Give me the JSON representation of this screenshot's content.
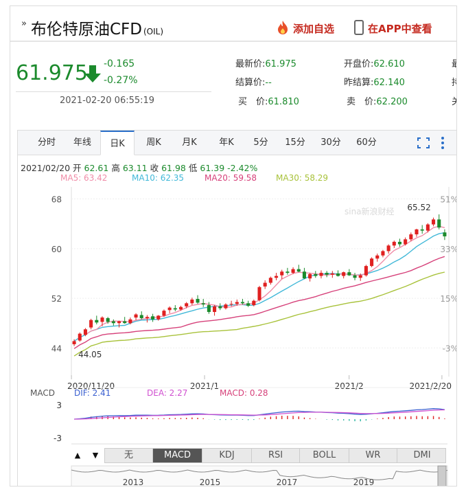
{
  "header": {
    "mark": "»",
    "title": "布伦特原油CFD",
    "title_sub": "(OIL)",
    "favorite_label": "添加自选",
    "app_label": "在APP中查看"
  },
  "price": {
    "last": "61.975",
    "change": "-0.165",
    "change_pct": "-0.27%",
    "time": "2021-02-20 06:55:19"
  },
  "quotes": [
    {
      "label": "最新价:",
      "value": "61.975"
    },
    {
      "label": "结算价:",
      "value": "--"
    },
    {
      "label": "买　价:",
      "value": "61.810"
    },
    {
      "label": "开盘价:",
      "value": "62.610"
    },
    {
      "label": "昨结算:",
      "value": "62.140"
    },
    {
      "label": "卖　价:",
      "value": "62.200"
    }
  ],
  "edge_partial": [
    "最",
    "持",
    "关"
  ],
  "tabs": [
    "分时",
    "年线",
    "日K",
    "周K",
    "月K",
    "年K",
    "5分",
    "15分",
    "30分",
    "60分"
  ],
  "active_tab": "日K",
  "info": {
    "date": "2021/02/20",
    "open_label": "开",
    "open": "62.61",
    "high_label": "高",
    "high": "63.11",
    "close_label": "收",
    "close": "61.98",
    "low_label": "低",
    "low": "61.39",
    "pct": "-2.42%",
    "ma5": "MA5: 63.42",
    "ma10": "MA10: 62.35",
    "ma20": "MA20: 59.58",
    "ma30": "MA30: 58.29"
  },
  "watermark": "sina新浪财经",
  "macd": {
    "label": "MACD",
    "dif": "DIF: 2.41",
    "dea": "DEA: 2.27",
    "macd": "MACD: 0.28"
  },
  "bottom_tabs": [
    "无",
    "MACD",
    "KDJ",
    "RSI",
    "BOLL",
    "WR",
    "DMI"
  ],
  "bottom_active": "MACD",
  "nav": [
    "▲",
    "▼"
  ],
  "colors": {
    "up": "#e02020",
    "down": "#1b8a2c",
    "ma5": "#f08ca8",
    "ma10": "#41b8d8",
    "ma20": "#d6417a",
    "ma30": "#a8c23a",
    "dif": "#3a5fd0",
    "dea": "#d050d0"
  },
  "chart_data": {
    "type": "candlestick",
    "y_ticks_left": [
      "68",
      "60",
      "52",
      "44"
    ],
    "y_ticks_right": [
      "51%",
      "33%",
      "15%",
      "-3%"
    ],
    "x_ticks": [
      "2020/11/20",
      "2021/1",
      "2021/2",
      "2021/2/20"
    ],
    "annotations": {
      "high": "65.52",
      "low": "44.05"
    },
    "ylim": [
      40.5,
      69.5
    ],
    "candles": [
      [
        44.6,
        45.4,
        44.3,
        45.1
      ],
      [
        45.2,
        46.5,
        45.0,
        46.3
      ],
      [
        46.1,
        47.2,
        45.9,
        47.0
      ],
      [
        47.3,
        48.7,
        47.0,
        48.5
      ],
      [
        48.5,
        49.2,
        47.8,
        48.1
      ],
      [
        48.2,
        49.1,
        47.5,
        48.9
      ],
      [
        48.8,
        49.0,
        47.9,
        48.2
      ],
      [
        48.3,
        48.6,
        47.6,
        48.0
      ],
      [
        48.0,
        48.4,
        47.3,
        48.3
      ],
      [
        48.3,
        49.0,
        47.9,
        48.0
      ],
      [
        48.0,
        48.9,
        47.8,
        48.6
      ],
      [
        48.9,
        49.6,
        48.5,
        49.4
      ],
      [
        49.3,
        49.9,
        48.6,
        48.8
      ],
      [
        48.8,
        49.3,
        48.1,
        49.0
      ],
      [
        49.1,
        49.5,
        48.2,
        48.6
      ],
      [
        48.6,
        49.3,
        48.4,
        49.2
      ],
      [
        49.2,
        50.2,
        49.0,
        50.0
      ],
      [
        50.1,
        50.7,
        49.6,
        50.5
      ],
      [
        50.4,
        50.9,
        49.9,
        50.2
      ],
      [
        50.2,
        50.8,
        50.0,
        50.6
      ],
      [
        50.7,
        51.4,
        50.4,
        51.2
      ],
      [
        51.2,
        52.1,
        50.9,
        51.8
      ],
      [
        51.9,
        52.5,
        51.1,
        51.3
      ],
      [
        51.2,
        51.9,
        50.6,
        51.0
      ],
      [
        50.9,
        51.4,
        49.5,
        49.8
      ],
      [
        49.8,
        50.9,
        49.2,
        50.7
      ],
      [
        50.7,
        51.2,
        50.1,
        50.4
      ],
      [
        50.4,
        51.2,
        50.2,
        51.0
      ],
      [
        51.0,
        51.6,
        50.7,
        51.1
      ],
      [
        51.1,
        51.8,
        50.8,
        51.4
      ],
      [
        51.4,
        51.9,
        51.0,
        51.2
      ],
      [
        51.2,
        51.6,
        50.6,
        50.8
      ],
      [
        50.9,
        51.8,
        50.7,
        51.6
      ],
      [
        51.7,
        54.0,
        51.5,
        53.8
      ],
      [
        53.9,
        54.9,
        53.5,
        54.5
      ],
      [
        54.5,
        55.5,
        54.2,
        55.3
      ],
      [
        55.3,
        56.1,
        54.9,
        55.6
      ],
      [
        55.7,
        56.6,
        55.1,
        56.3
      ],
      [
        56.3,
        56.9,
        55.8,
        56.1
      ],
      [
        56.1,
        57.0,
        55.9,
        56.7
      ],
      [
        56.7,
        57.4,
        56.2,
        56.3
      ],
      [
        56.3,
        56.9,
        55.1,
        55.2
      ],
      [
        55.2,
        56.1,
        54.7,
        55.9
      ],
      [
        55.9,
        56.4,
        55.3,
        55.6
      ],
      [
        55.6,
        56.5,
        55.2,
        56.1
      ],
      [
        56.1,
        56.4,
        55.4,
        55.8
      ],
      [
        55.8,
        56.4,
        55.3,
        56.0
      ],
      [
        56.0,
        56.5,
        55.5,
        55.6
      ],
      [
        55.6,
        56.3,
        55.2,
        56.2
      ],
      [
        56.2,
        56.7,
        55.6,
        55.7
      ],
      [
        55.7,
        56.1,
        54.9,
        55.3
      ],
      [
        55.3,
        56.0,
        54.8,
        55.7
      ],
      [
        55.7,
        57.4,
        55.5,
        57.2
      ],
      [
        57.2,
        58.6,
        57.0,
        58.4
      ],
      [
        58.4,
        59.2,
        57.9,
        58.9
      ],
      [
        58.9,
        59.8,
        58.6,
        59.6
      ],
      [
        59.6,
        60.7,
        59.2,
        60.5
      ],
      [
        60.5,
        61.3,
        60.1,
        61.1
      ],
      [
        61.1,
        61.6,
        60.3,
        60.7
      ],
      [
        60.7,
        61.8,
        60.5,
        61.5
      ],
      [
        61.5,
        62.6,
        61.2,
        62.3
      ],
      [
        62.3,
        63.2,
        61.9,
        63.1
      ],
      [
        63.1,
        63.8,
        62.4,
        62.9
      ],
      [
        62.9,
        64.1,
        62.6,
        63.9
      ],
      [
        63.9,
        65.0,
        63.6,
        64.7
      ],
      [
        64.7,
        65.52,
        63.1,
        63.4
      ],
      [
        62.61,
        63.11,
        61.39,
        61.98
      ]
    ]
  }
}
